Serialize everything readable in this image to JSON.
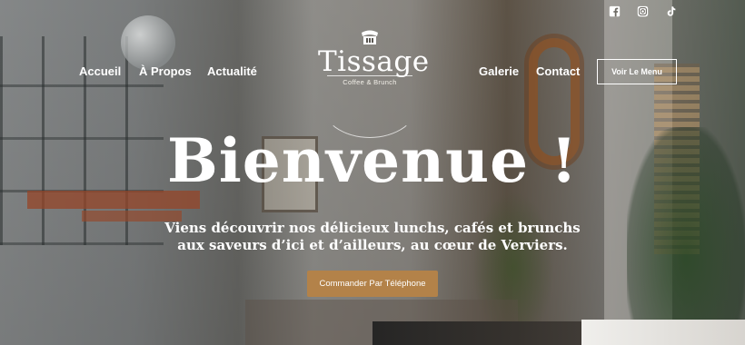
{
  "social": {
    "icons": [
      "facebook-icon",
      "instagram-icon",
      "tiktok-icon"
    ]
  },
  "nav": {
    "left": [
      "Accueil",
      "À Propos",
      "Actualité"
    ],
    "right": [
      "Galerie",
      "Contact"
    ],
    "menu_button": "Voir Le Menu"
  },
  "logo": {
    "name": "Tissage",
    "tagline": "Coffee & Brunch"
  },
  "hero": {
    "title": "Bienvenue !",
    "subtitle": "Viens découvrir nos délicieux lunchs, cafés et brunchs aux saveurs d’ici et d’ailleurs, au cœur de Verviers.",
    "cta": "Commander Par Téléphone"
  },
  "colors": {
    "accent": "#b38249",
    "text": "#ffffff"
  }
}
